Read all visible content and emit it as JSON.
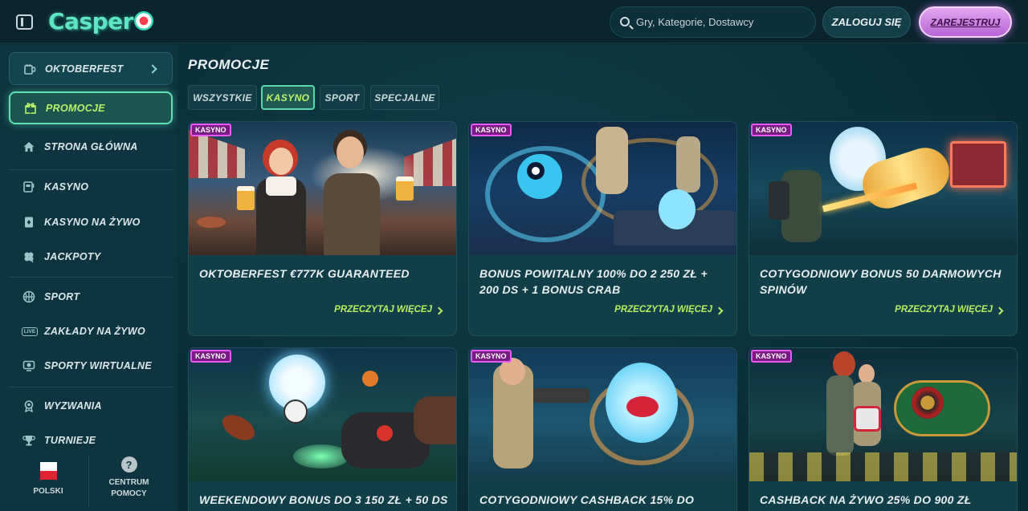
{
  "header": {
    "logo_text": "Casper",
    "search_placeholder": "Gry, Kategorie, Dostawcy",
    "login_label": "ZALOGUJ SIĘ",
    "register_label": "ZAREJESTRUJ"
  },
  "sidebar": {
    "oktoberfest": "OKTOBERFEST",
    "promocje": "PROMOCJE",
    "items": [
      {
        "label": "STRONA GŁÓWNA",
        "icon": "home-icon"
      },
      {
        "label": "KASYNO",
        "icon": "slot-machine-icon"
      },
      {
        "label": "KASYNO NA ŻYWO",
        "icon": "card-icon"
      },
      {
        "label": "JACKPOTY",
        "icon": "clover-icon"
      },
      {
        "label": "SPORT",
        "icon": "basketball-icon"
      },
      {
        "label": "ZAKŁADY NA ŻYWO",
        "icon": "live-icon"
      },
      {
        "label": "SPORTY WIRTUALNE",
        "icon": "virtual-ball-icon"
      },
      {
        "label": "WYZWANIA",
        "icon": "badge-icon"
      },
      {
        "label": "TURNIEJE",
        "icon": "trophy-icon"
      }
    ],
    "live_icon_text": "LIVE",
    "language": "POLSKI",
    "help_center": [
      "CENTRUM",
      "POMOCY"
    ],
    "help_icon_text": "?"
  },
  "main": {
    "title": "PROMOCJE",
    "tabs": [
      {
        "label": "WSZYSTKIE",
        "active": false
      },
      {
        "label": "KASYNO",
        "active": true
      },
      {
        "label": "SPORT",
        "active": false
      },
      {
        "label": "SPECJALNE",
        "active": false
      }
    ],
    "cards": [
      {
        "badge": "KASYNO",
        "title": "OKTOBERFEST €777K GUARANTEED",
        "more": "PRZECZYTAJ WIĘCEJ"
      },
      {
        "badge": "KASYNO",
        "title": "BONUS POWITALNY 100% DO 2 250 ZŁ + 200 DS + 1 BONUS CRAB",
        "more": "PRZECZYTAJ WIĘCEJ"
      },
      {
        "badge": "KASYNO",
        "title": "COTYGODNIOWY BONUS 50 DARMOWYCH SPINÓW",
        "more": "PRZECZYTAJ WIĘCEJ"
      },
      {
        "badge": "KASYNO",
        "title": "WEEKENDOWY BONUS DO 3 150 ZŁ + 50 DS",
        "more": ""
      },
      {
        "badge": "KASYNO",
        "title": "COTYGODNIOWY CASHBACK 15% DO",
        "more": ""
      },
      {
        "badge": "KASYNO",
        "title": "CASHBACK NA ŻYWO 25% DO 900 ZŁ",
        "more": ""
      }
    ]
  },
  "colors": {
    "accent_green": "#b7ef5f",
    "accent_teal": "#5ee6c4",
    "badge_magenta": "#e75cf0",
    "register_purple": "#c77ae0"
  }
}
